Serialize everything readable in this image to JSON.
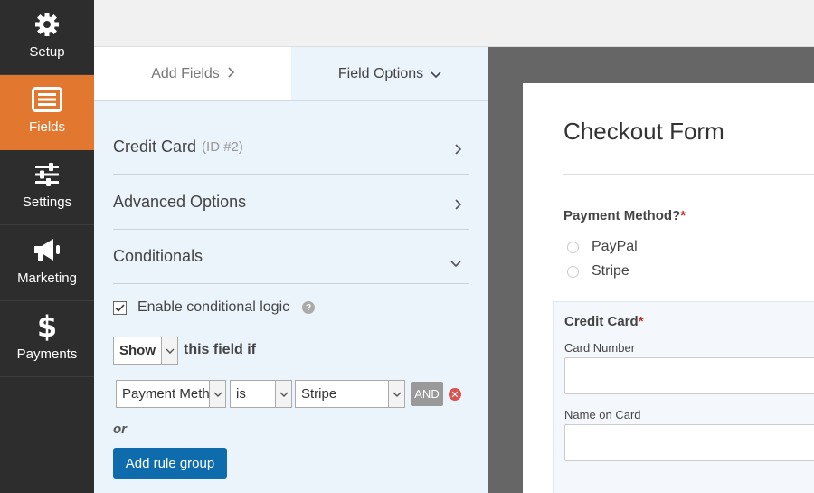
{
  "sidebar": {
    "items": [
      {
        "label": "Setup",
        "icon": "gear-icon"
      },
      {
        "label": "Fields",
        "icon": "fields-list-icon"
      },
      {
        "label": "Settings",
        "icon": "sliders-icon"
      },
      {
        "label": "Marketing",
        "icon": "megaphone-icon"
      },
      {
        "label": "Payments",
        "icon": "dollar-icon"
      }
    ],
    "active": "Fields",
    "colors": {
      "background": "#2d2d2d",
      "active": "#e27730"
    }
  },
  "panel": {
    "tabs": [
      {
        "label": "Add Fields"
      },
      {
        "label": "Field Options"
      }
    ],
    "sections": [
      {
        "label": "Credit Card",
        "sub": "(ID #2)"
      },
      {
        "label": "Advanced Options"
      },
      {
        "label": "Conditionals"
      }
    ],
    "conditional": {
      "enable_label": "Enable conditional logic",
      "enabled": true,
      "action_value": "Show",
      "action_suffix": "this field if",
      "rule": {
        "field": "Payment Meth",
        "operator": "is",
        "value": "Stripe",
        "and_label": "AND"
      },
      "or_label": "or",
      "add_group_label": "Add rule group"
    }
  },
  "preview": {
    "form_title": "Checkout Form",
    "payment_method": {
      "label": "Payment Method?",
      "required_mark": "*",
      "options": [
        "PayPal",
        "Stripe"
      ]
    },
    "credit_card": {
      "label": "Credit Card",
      "required_mark": "*",
      "card_number_label": "Card Number",
      "name_on_card_label": "Name on Card"
    }
  }
}
